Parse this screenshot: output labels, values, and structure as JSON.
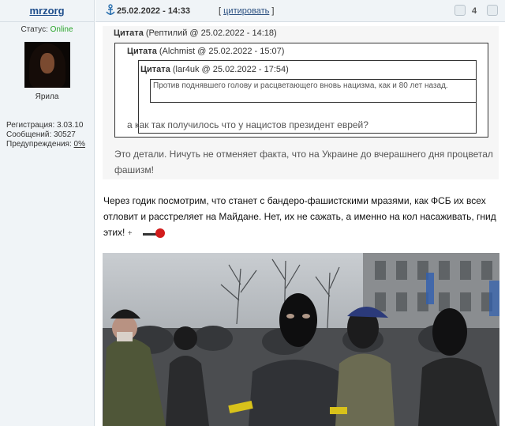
{
  "user": {
    "name": "mrzorg",
    "status_label": "Статус:",
    "status_value": "Online",
    "rank": "Ярила",
    "reg_label": "Регистрация:",
    "reg_value": "3.03.10",
    "msgs_label": "Сообщений:",
    "msgs_value": "30527",
    "warn_label": "Предупреждения:",
    "warn_value": "0%"
  },
  "post": {
    "datetime": "25.02.2022 - 14:33",
    "cite_open": "[",
    "cite_label": "цитировать",
    "cite_close": "]",
    "rating": "4"
  },
  "quotes": {
    "q1": {
      "label": "Цитата",
      "meta": "(Рептилий @ 25.02.2022 - 14:18)",
      "reply": "Это детали. Ничуть не отменяет факта, что на Украине до вчерашнего дня процветал фашизм!"
    },
    "q2": {
      "label": "Цитата",
      "meta": "(Alchmist @ 25.02.2022 - 15:07)"
    },
    "q3": {
      "label": "Цитата",
      "meta": "(lar4uk @ 25.02.2022 - 17:54)",
      "reply": "а как так получилось что у нацистов президент еврей?"
    },
    "q4": {
      "text": "Против поднявшего голову и расцветающего вновь нацизма, как и 80 лет назад."
    }
  },
  "body": {
    "text": "Через годик посмотрим, что станет с бандеро-фашистскими мразями, как ФСБ их всех отловит и расстреляет на Майдане. Нет, их не сажать, а именно на кол насаживать, гнид этих!",
    "plus": "+"
  },
  "icons": {
    "anchor": "anchor-icon",
    "rate_plus": "rate-up-icon",
    "rate_minus": "rate-down-icon",
    "smiley": "gun-smiley-icon"
  },
  "colors": {
    "panel_bg": "#f0f4f7",
    "online": "#2aa52a",
    "username": "#1f4e8c"
  }
}
